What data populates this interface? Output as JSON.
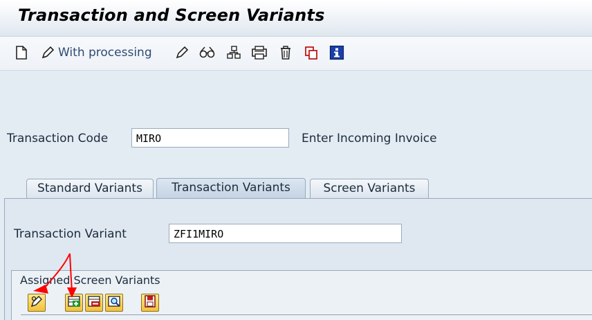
{
  "window": {
    "title": "Transaction and Screen Variants"
  },
  "toolbar": {
    "items": [
      {
        "icon": "new-document-icon"
      },
      {
        "icon": "pencil-icon",
        "label": "With processing"
      },
      {
        "icon": "change-pencil-icon"
      },
      {
        "icon": "glasses-display-icon"
      },
      {
        "icon": "hierarchy-icon"
      },
      {
        "icon": "printer-icon"
      },
      {
        "icon": "trash-icon"
      },
      {
        "icon": "copy-icon"
      },
      {
        "icon": "info-icon"
      }
    ]
  },
  "form": {
    "transaction_code": {
      "label": "Transaction Code",
      "value": "MIRO",
      "description": "Enter Incoming Invoice"
    }
  },
  "tabs": [
    {
      "label": "Standard Variants",
      "active": false
    },
    {
      "label": "Transaction Variants",
      "active": true
    },
    {
      "label": "Screen Variants",
      "active": false
    }
  ],
  "tab_content": {
    "transaction_variant": {
      "label": "Transaction Variant",
      "value": "ZFI1MIRO"
    },
    "assigned_screen_variants": {
      "header": "Assigned Screen Variants",
      "buttons": [
        "edit-icon",
        "insert-row-icon",
        "delete-row-icon",
        "find-icon",
        "save-icon"
      ]
    }
  },
  "colors": {
    "annotation_arrow": "#ff0000",
    "tab_active": "#c9d7e6",
    "title_text": "#000000"
  }
}
